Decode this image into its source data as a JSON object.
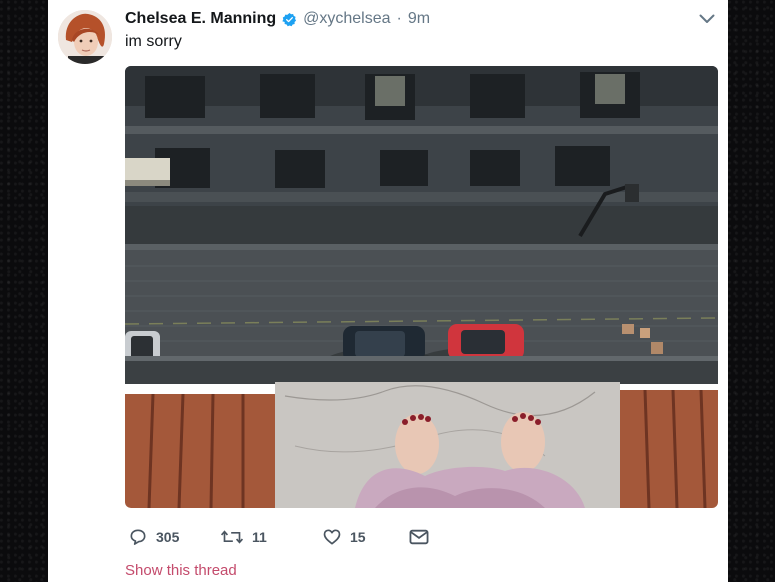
{
  "tweet": {
    "display_name": "Chelsea E. Manning",
    "handle": "@xychelsea",
    "separator": "·",
    "time": "9m",
    "text": "im sorry",
    "show_thread": "Show this thread"
  },
  "actions": {
    "reply_count": "305",
    "retweet_count": "11",
    "like_count": "15"
  },
  "icons": {
    "verified": "verified-badge-icon",
    "caret": "chevron-down-icon",
    "reply": "reply-icon",
    "retweet": "retweet-icon",
    "like": "heart-icon",
    "dm": "mail-icon"
  },
  "colors": {
    "verified": "#1da1f2",
    "link": "#c44b6c",
    "muted": "#657786"
  }
}
